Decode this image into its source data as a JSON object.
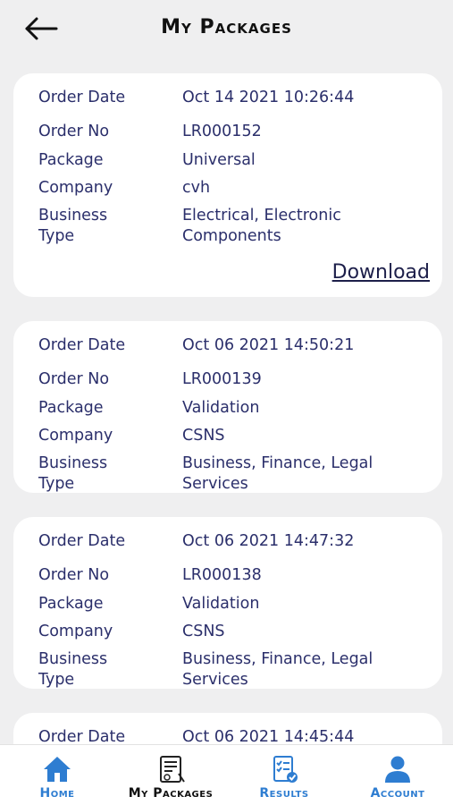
{
  "header": {
    "title": "My Packages",
    "back_icon": "arrow-left-icon"
  },
  "labels": {
    "order_date": "Order Date",
    "order_no": "Order No",
    "package": "Package",
    "company": "Company",
    "business_type_1": "Business",
    "business_type_2": "Type"
  },
  "orders": [
    {
      "order_date": "Oct 14 2021 10:26:44",
      "order_no": "LR000152",
      "package": "Universal",
      "company": "cvh",
      "business_type_1": "Electrical, Electronic",
      "business_type_2": "Components",
      "download": "Download"
    },
    {
      "order_date": "Oct 06 2021 14:50:21",
      "order_no": "LR000139",
      "package": "Validation",
      "company": "CSNS",
      "business_type_1": "Business, Finance, Legal",
      "business_type_2": "Services"
    },
    {
      "order_date": "Oct 06 2021 14:47:32",
      "order_no": "LR000138",
      "package": "Validation",
      "company": "CSNS",
      "business_type_1": "Business, Finance, Legal",
      "business_type_2": "Services"
    },
    {
      "order_date": "Oct 06 2021 14:45:44"
    }
  ],
  "nav": {
    "home": "Home",
    "my_packages": "My Packages",
    "results": "Results",
    "account": "Account"
  },
  "colors": {
    "accent": "#2e7dd1",
    "text": "#2b2f6b",
    "background": "#efeff0"
  }
}
